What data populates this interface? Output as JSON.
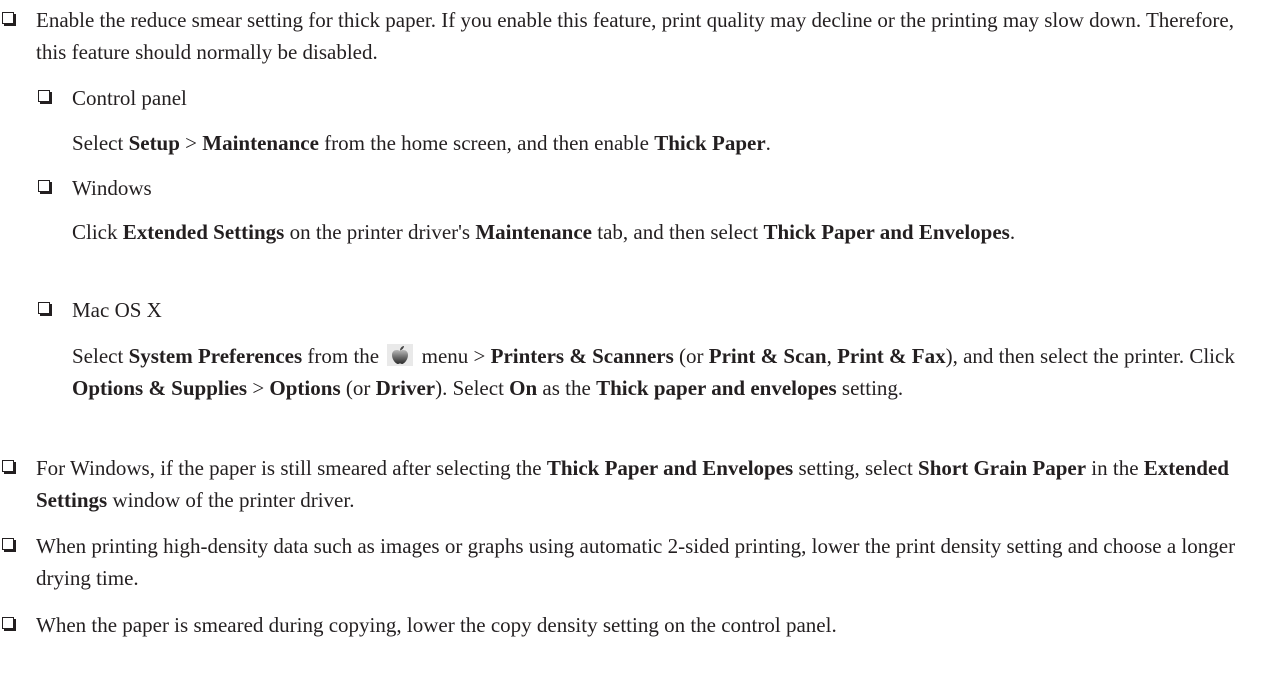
{
  "bullets": {
    "b1": "Enable the reduce smear setting for thick paper. If you enable this feature, print quality may decline or the printing may slow down. Therefore, this feature should normally be disabled.",
    "control_panel": {
      "heading": "Control panel",
      "t1": "Select ",
      "s1": "Setup",
      "t2": " > ",
      "s2": "Maintenance",
      "t3": " from the home screen, and then enable ",
      "s3": "Thick Paper",
      "t4": "."
    },
    "windows": {
      "heading": "Windows",
      "t1": "Click ",
      "s1": "Extended Settings",
      "t2": " on the printer driver's ",
      "s2": "Maintenance",
      "t3": " tab, and then select ",
      "s3": "Thick Paper and Envelopes",
      "t4": "."
    },
    "mac": {
      "heading": "Mac OS X",
      "t1": "Select ",
      "s1": "System Preferences",
      "t2": " from the ",
      "icon": "apple-menu-icon",
      "t3": " menu > ",
      "s2": "Printers & Scanners",
      "t4": " (or ",
      "s3": "Print & Scan",
      "t5": ", ",
      "s4": "Print & Fax",
      "t6": "), and then select the printer. Click ",
      "s5": "Options & Supplies",
      "t7": " > ",
      "s6": "Options",
      "t8": " (or ",
      "s7": "Driver",
      "t9": "). Select ",
      "s8": "On",
      "t10": " as the ",
      "s9": "Thick paper and envelopes",
      "t11": " setting."
    },
    "b2": {
      "t1": "For Windows, if the paper is still smeared after selecting the ",
      "s1": "Thick Paper and Envelopes",
      "t2": " setting, select ",
      "s2": "Short Grain Paper",
      "t3": " in the ",
      "s3": "Extended Settings",
      "t4": " window of the printer driver."
    },
    "b3": "When printing high-density data such as images or graphs using automatic 2-sided printing, lower the print density setting and choose a longer drying time.",
    "b4": "When the paper is smeared during copying, lower the copy density setting on the control panel."
  }
}
